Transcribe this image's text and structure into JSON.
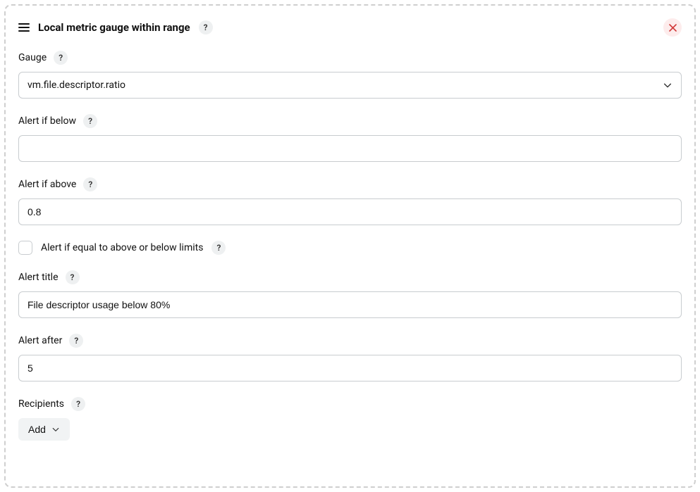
{
  "header": {
    "title": "Local metric gauge within range",
    "help": "?"
  },
  "fields": {
    "gauge": {
      "label": "Gauge",
      "help": "?",
      "value": "vm.file.descriptor.ratio"
    },
    "alert_below": {
      "label": "Alert if below",
      "help": "?",
      "value": ""
    },
    "alert_above": {
      "label": "Alert if above",
      "help": "?",
      "value": "0.8"
    },
    "alert_equal": {
      "label": "Alert if equal to above or below limits",
      "help": "?",
      "checked": false
    },
    "alert_title": {
      "label": "Alert title",
      "help": "?",
      "value": "File descriptor usage below 80%"
    },
    "alert_after": {
      "label": "Alert after",
      "help": "?",
      "value": "5"
    },
    "recipients": {
      "label": "Recipients",
      "help": "?",
      "add_label": "Add"
    }
  }
}
